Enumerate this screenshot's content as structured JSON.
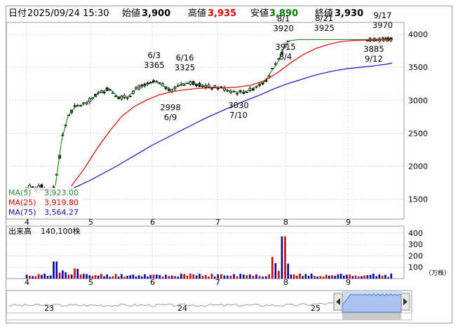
{
  "header": {
    "date_label": "日付",
    "datetime": "2025/09/24 15:30",
    "open_label": "始値",
    "open_value": "3,900",
    "high_label": "高値",
    "high_value": "3,935",
    "low_label": "安値",
    "low_value": "3,890",
    "close_label": "終値",
    "close_value": "3,930",
    "high_color": "#e00000",
    "low_color": "#008000"
  },
  "ma_legend": [
    {
      "label": "MA(5)",
      "value": "3,923.00",
      "color": "#2e8b2e"
    },
    {
      "label": "MA(25)",
      "value": "3,919.80",
      "color": "#e00000"
    },
    {
      "label": "MA(75)",
      "value": "3,564.27",
      "color": "#1010d0"
    }
  ],
  "volume_label": "出来高",
  "volume_value": "140,100株",
  "volume_unit": "（万株）",
  "navigator_labels": [
    "23",
    "24",
    "25"
  ],
  "chart_data": [
    {
      "type": "candlestick",
      "x_tick_labels": [
        "4",
        "5",
        "6",
        "7",
        "8",
        "9"
      ],
      "y_tick_labels": [
        "1500",
        "2000",
        "2500",
        "3000",
        "3500",
        "4000"
      ],
      "ylim": [
        1200,
        4180
      ],
      "up_color": "#0000aa",
      "down_color": "#d00000",
      "annotations": [
        {
          "date": "6/3",
          "value": "3365",
          "month": 6.03,
          "price": 3365,
          "pos": "above"
        },
        {
          "date": "6/16",
          "value": "3325",
          "month": 6.5,
          "price": 3325,
          "pos": "above"
        },
        {
          "date": "6/9",
          "value": "2998",
          "month": 6.28,
          "price": 2998,
          "pos": "below"
        },
        {
          "date": "7/10",
          "value": "3030",
          "month": 7.31,
          "price": 3030,
          "pos": "below"
        },
        {
          "date": "8/1",
          "value": "3920",
          "month": 7.97,
          "price": 3920,
          "pos": "above"
        },
        {
          "date": "8/4",
          "value": "3915",
          "month": 8.0,
          "price": 3915,
          "pos": "below"
        },
        {
          "date": "8/21",
          "value": "3925",
          "month": 8.62,
          "price": 3925,
          "pos": "above"
        },
        {
          "date": "9/12",
          "value": "3885",
          "month": 9.41,
          "price": 3885,
          "pos": "below"
        },
        {
          "date": "9/17",
          "value": "3970",
          "month": 9.55,
          "price": 3970,
          "pos": "above"
        }
      ],
      "series": [
        {
          "name": "MA(5)",
          "color": "#2e8b2e",
          "points": [
            [
              4.45,
              1710
            ],
            [
              4.55,
              2400
            ],
            [
              4.65,
              2770
            ],
            [
              4.75,
              2890
            ],
            [
              4.9,
              2950
            ],
            [
              5.0,
              3010
            ],
            [
              5.15,
              3120
            ],
            [
              5.3,
              3180
            ],
            [
              5.45,
              3050
            ],
            [
              5.6,
              3050
            ],
            [
              5.75,
              3180
            ],
            [
              5.9,
              3230
            ],
            [
              6.05,
              3280
            ],
            [
              6.2,
              3200
            ],
            [
              6.3,
              3160
            ],
            [
              6.45,
              3250
            ],
            [
              6.6,
              3270
            ],
            [
              6.75,
              3230
            ],
            [
              6.9,
              3200
            ],
            [
              7.05,
              3190
            ],
            [
              7.2,
              3140
            ],
            [
              7.35,
              3120
            ],
            [
              7.5,
              3160
            ],
            [
              7.6,
              3230
            ],
            [
              7.7,
              3290
            ],
            [
              7.78,
              3420
            ],
            [
              7.88,
              3560
            ],
            [
              7.97,
              3780
            ],
            [
              8.05,
              3900
            ],
            [
              8.2,
              3920
            ],
            [
              8.5,
              3920
            ],
            [
              8.8,
              3920
            ],
            [
              9.1,
              3920
            ],
            [
              9.3,
              3920
            ],
            [
              9.5,
              3930
            ],
            [
              9.7,
              3923
            ]
          ]
        },
        {
          "name": "MA(25)",
          "color": "#e00000",
          "points": [
            [
              4.7,
              1700
            ],
            [
              4.9,
              1960
            ],
            [
              5.1,
              2260
            ],
            [
              5.3,
              2520
            ],
            [
              5.5,
              2750
            ],
            [
              5.7,
              2900
            ],
            [
              5.9,
              3000
            ],
            [
              6.1,
              3080
            ],
            [
              6.3,
              3130
            ],
            [
              6.5,
              3160
            ],
            [
              6.7,
              3180
            ],
            [
              6.9,
              3190
            ],
            [
              7.1,
              3190
            ],
            [
              7.3,
              3200
            ],
            [
              7.5,
              3230
            ],
            [
              7.7,
              3300
            ],
            [
              7.9,
              3430
            ],
            [
              8.1,
              3580
            ],
            [
              8.3,
              3700
            ],
            [
              8.5,
              3790
            ],
            [
              8.7,
              3850
            ],
            [
              8.9,
              3890
            ],
            [
              9.1,
              3905
            ],
            [
              9.3,
              3912
            ],
            [
              9.5,
              3918
            ],
            [
              9.7,
              3919.8
            ]
          ]
        },
        {
          "name": "MA(75)",
          "color": "#1010d0",
          "points": [
            [
              4.6,
              1620
            ],
            [
              4.8,
              1700
            ],
            [
              5.0,
              1790
            ],
            [
              5.2,
              1890
            ],
            [
              5.4,
              1990
            ],
            [
              5.6,
              2100
            ],
            [
              5.8,
              2210
            ],
            [
              6.0,
              2320
            ],
            [
              6.2,
              2420
            ],
            [
              6.4,
              2520
            ],
            [
              6.6,
              2620
            ],
            [
              6.8,
              2720
            ],
            [
              7.0,
              2810
            ],
            [
              7.2,
              2900
            ],
            [
              7.4,
              2990
            ],
            [
              7.6,
              3070
            ],
            [
              7.8,
              3160
            ],
            [
              8.0,
              3240
            ],
            [
              8.2,
              3300
            ],
            [
              8.4,
              3360
            ],
            [
              8.6,
              3410
            ],
            [
              8.8,
              3450
            ],
            [
              9.0,
              3480
            ],
            [
              9.2,
              3500
            ],
            [
              9.4,
              3520
            ],
            [
              9.6,
              3545
            ],
            [
              9.7,
              3564.27
            ]
          ]
        }
      ]
    },
    {
      "type": "bar",
      "title": "出来高",
      "y_tick_labels": [
        "100",
        "200",
        "300",
        "400"
      ],
      "ylim": [
        0,
        460
      ],
      "x_tick_labels": [
        "4",
        "5",
        "6",
        "7",
        "8",
        "9"
      ]
    }
  ]
}
